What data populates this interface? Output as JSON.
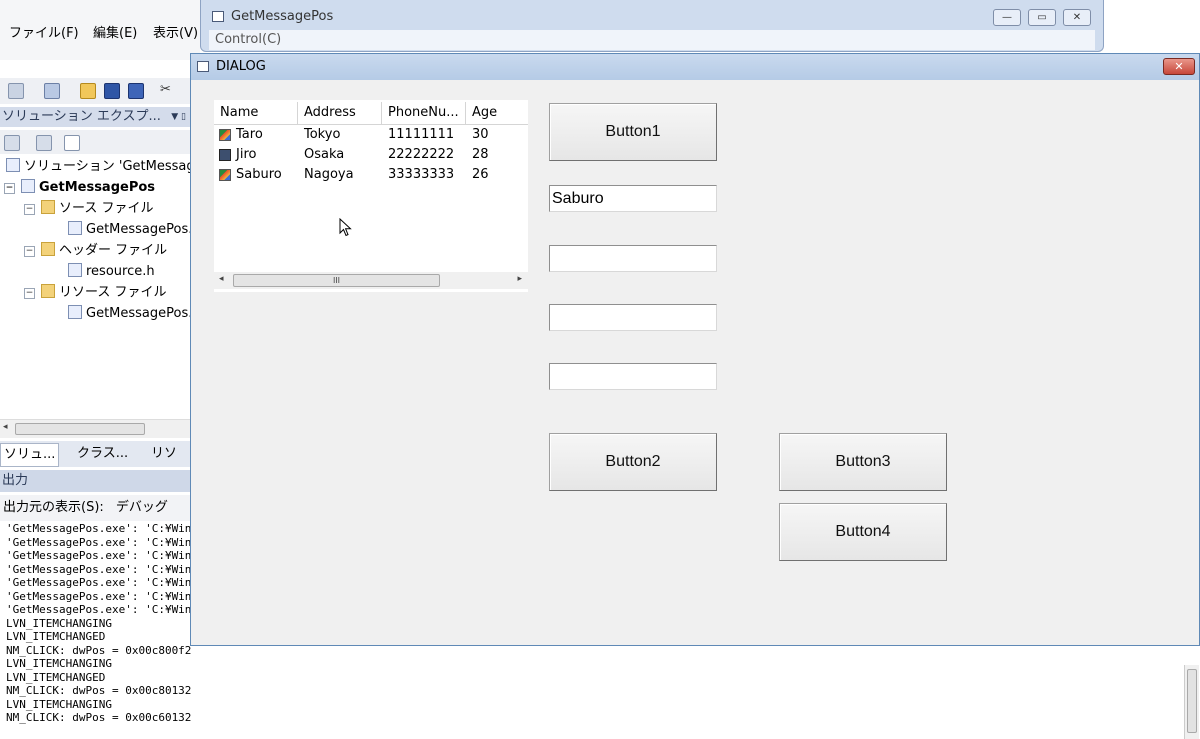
{
  "ide": {
    "menus": [
      "ファイル(F)",
      "編集(E)",
      "表示(V)"
    ],
    "solution_explorer": {
      "title": "ソリューション エクスプ...",
      "tree": {
        "solution": "ソリューション 'GetMessag",
        "project": "GetMessagePos",
        "source_folder": "ソース ファイル",
        "source_file": "GetMessagePos.c",
        "header_folder": "ヘッダー ファイル",
        "header_file": "resource.h",
        "resource_folder": "リソース ファイル",
        "resource_file": "GetMessagePos.r"
      },
      "tabs": [
        "ソリュ...",
        "クラス...",
        "リソ"
      ]
    },
    "output": {
      "title": "出力",
      "source_label": "出力元の表示(S):",
      "source_value": "デバッグ",
      "lines": [
        "'GetMessagePos.exe': 'C:¥Wind",
        "'GetMessagePos.exe': 'C:¥Wind",
        "'GetMessagePos.exe': 'C:¥Wind",
        "'GetMessagePos.exe': 'C:¥Wind",
        "'GetMessagePos.exe': 'C:¥Wind",
        "'GetMessagePos.exe': 'C:¥Wind",
        "'GetMessagePos.exe': 'C:¥Wind",
        "LVN_ITEMCHANGING",
        "LVN_ITEMCHANGED",
        "NM_CLICK: dwPos = 0x00c800f2",
        "LVN_ITEMCHANGING",
        "LVN_ITEMCHANGED",
        "NM_CLICK: dwPos = 0x00c80132",
        "LVN_ITEMCHANGING",
        "NM_CLICK: dwPos = 0x00c60132"
      ]
    }
  },
  "getmessagepos_window": {
    "title": "GetMessagePos",
    "menu": "Control(C)"
  },
  "dialog": {
    "title": "DIALOG",
    "listview": {
      "columns": [
        "Name",
        "Address",
        "PhoneNu...",
        "Age"
      ],
      "rows": [
        {
          "name": "Taro",
          "address": "Tokyo",
          "phone": "11111111",
          "age": "30",
          "icon": "pencil-icon"
        },
        {
          "name": "Jiro",
          "address": "Osaka",
          "phone": "22222222",
          "age": "28",
          "icon": "monitor-icon"
        },
        {
          "name": "Saburo",
          "address": "Nagoya",
          "phone": "33333333",
          "age": "26",
          "icon": "pencil-icon"
        }
      ]
    },
    "buttons": {
      "button1": "Button1",
      "button2": "Button2",
      "button3": "Button3",
      "button4": "Button4"
    },
    "edits": {
      "edit1": "Saburo",
      "edit2": "",
      "edit3": "",
      "edit4": ""
    }
  }
}
